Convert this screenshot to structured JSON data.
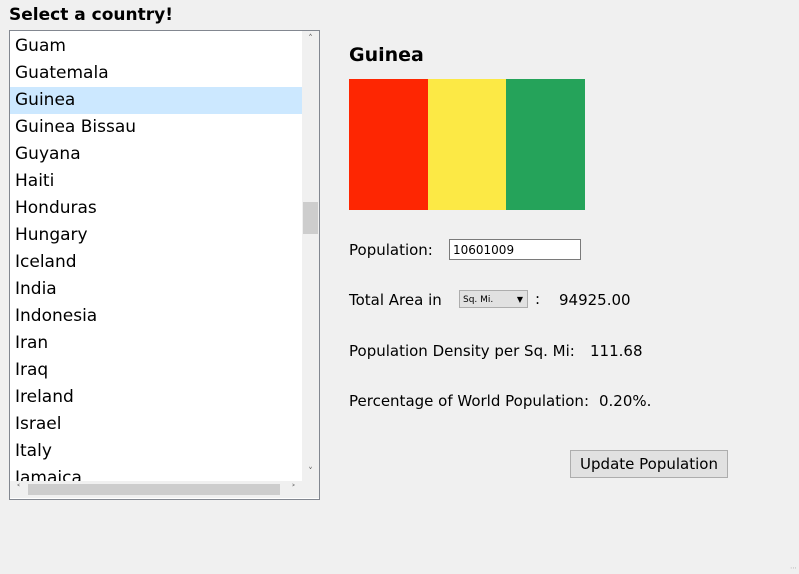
{
  "heading": "Select a country!",
  "countries": [
    "Guam",
    "Guatemala",
    "Guinea",
    "Guinea Bissau",
    "Guyana",
    "Haiti",
    "Honduras",
    "Hungary",
    "Iceland",
    "India",
    "Indonesia",
    "Iran",
    "Iraq",
    "Ireland",
    "Israel",
    "Italy",
    "Jamaica"
  ],
  "selected_country": "Guinea",
  "flag_colors": [
    "#fe2602",
    "#fce945",
    "#25a35a"
  ],
  "details": {
    "population_label": "Population:",
    "population_value": "10601009",
    "area_label": "Total Area in",
    "area_unit": "Sq. Mi.",
    "area_sep": ":",
    "area_value": "94925.00",
    "density_label": "Population Density per Sq. Mi:",
    "density_value": "111.68",
    "percent_label": "Percentage of World Population:",
    "percent_value": "0.20%."
  },
  "buttons": {
    "update": "Update Population"
  },
  "icons": {
    "scroll_up": "chevron-up-icon",
    "scroll_down": "chevron-down-icon",
    "scroll_left": "chevron-left-icon",
    "scroll_right": "chevron-right-icon",
    "dropdown": "caret-down-icon",
    "resize_grip": "resize-grip-icon"
  }
}
